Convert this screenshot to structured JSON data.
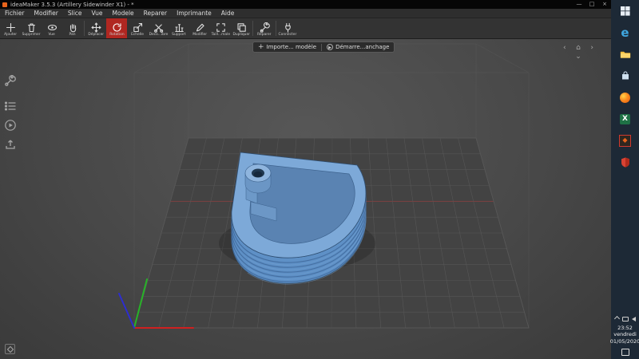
{
  "window": {
    "title": "ideaMaker 3.5.3 (Artillery Sidewinder X1) - *",
    "controls": {
      "minimize": "—",
      "maximize": "□",
      "close": "×"
    }
  },
  "menubar": {
    "items": [
      "Fichier",
      "Modifier",
      "Slice",
      "Vue",
      "Modele",
      "Reparer",
      "Imprimante",
      "Aide"
    ]
  },
  "toolbar": {
    "separators_after": [
      3,
      11,
      12
    ],
    "buttons": [
      {
        "label": "Ajouter",
        "icon": "plus"
      },
      {
        "label": "Supprimer",
        "icon": "trash"
      },
      {
        "label": "Vue",
        "icon": "eye"
      },
      {
        "label": "Pan",
        "icon": "hand"
      },
      {
        "label": "Déplacer",
        "icon": "move"
      },
      {
        "label": "Rotation",
        "icon": "rotate",
        "active": true
      },
      {
        "label": "Echelle",
        "icon": "scale"
      },
      {
        "label": "Deco...ibre",
        "icon": "cut"
      },
      {
        "label": "Support",
        "icon": "support"
      },
      {
        "label": "Modifier",
        "icon": "edit"
      },
      {
        "label": "Taill...male",
        "icon": "max"
      },
      {
        "label": "Dupliquer",
        "icon": "duplicate"
      },
      {
        "label": "Réparer",
        "icon": "repair"
      },
      {
        "label": "Connecter",
        "icon": "connect"
      }
    ]
  },
  "viewport_actions": {
    "import_label": "Importe... modèle",
    "slice_label": "Démarre...anchage"
  },
  "nav": {
    "left": "‹",
    "right": "›",
    "home": "⌂",
    "down": "⌄"
  },
  "taskbar": {
    "apps": [
      {
        "name": "start"
      },
      {
        "name": "edge"
      },
      {
        "name": "folder"
      },
      {
        "name": "store"
      },
      {
        "name": "firefox"
      },
      {
        "name": "excel"
      },
      {
        "name": "ideamaker",
        "active": true
      },
      {
        "name": "defender"
      }
    ],
    "time": "23:52",
    "day": "vendredi",
    "date": "01/05/2020"
  },
  "colors": {
    "toolbar_active": "#b02721",
    "model_blue": "#7da9d8",
    "taskbar_bg": "#1d2936"
  }
}
